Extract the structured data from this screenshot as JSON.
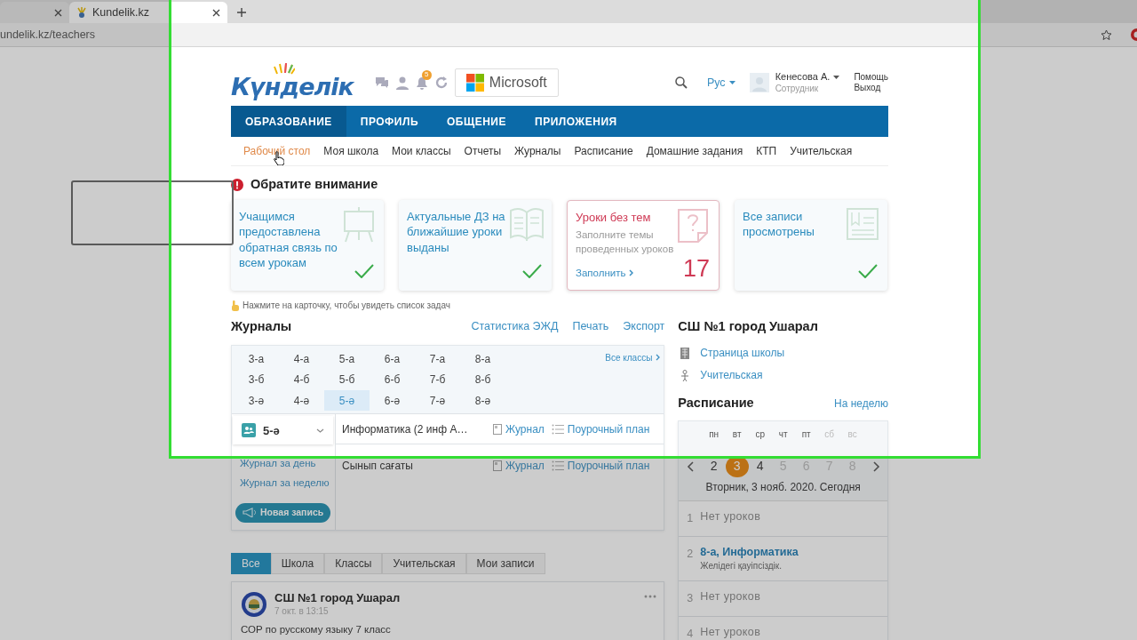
{
  "browser": {
    "tabs": [
      {
        "selected": false
      },
      {
        "title": "Kundelik.kz",
        "selected": true
      }
    ],
    "address": "undelik.kz/teachers"
  },
  "header": {
    "logo": "Күнделік",
    "notifications": "5",
    "microsoft": "Microsoft",
    "language": "Рус",
    "user": {
      "name": "Кенесова А.",
      "role": "Сотрудник"
    },
    "links": [
      "Помощь",
      "Выход"
    ]
  },
  "nav": [
    {
      "label": "ОБРАЗОВАНИЕ",
      "selected": true
    },
    {
      "label": "ПРОФИЛЬ",
      "selected": false
    },
    {
      "label": "ОБЩЕНИЕ",
      "selected": false
    },
    {
      "label": "ПРИЛОЖЕНИЯ",
      "selected": false
    }
  ],
  "subnav": [
    {
      "label": "Рабочий стол",
      "selected": true
    },
    {
      "label": "Моя школа",
      "selected": false
    },
    {
      "label": "Мои классы",
      "selected": false
    },
    {
      "label": "Отчеты",
      "selected": false
    },
    {
      "label": "Журналы",
      "selected": false
    },
    {
      "label": "Расписание",
      "selected": false
    },
    {
      "label": "Домашние задания",
      "selected": false
    },
    {
      "label": "КТП",
      "selected": false
    },
    {
      "label": "Учительская",
      "selected": false
    }
  ],
  "attention": {
    "title": "Обратите внимание",
    "cards": [
      {
        "kind": "done",
        "title": "Учащимся предоставлена обратная связь по всем урокам"
      },
      {
        "kind": "done",
        "title": "Актуальные ДЗ на ближайшие уроки выданы"
      },
      {
        "kind": "todo",
        "title": "Уроки без тем",
        "text": "Заполните темы проведенных уроков",
        "action": "Заполнить",
        "count": "17"
      },
      {
        "kind": "done",
        "title": "Все записи просмотрены"
      }
    ],
    "hint": "Нажмите на карточку, чтобы увидеть список задач"
  },
  "journals": {
    "title": "Журналы",
    "links": [
      "Статистика ЭЖД",
      "Печать",
      "Экспорт"
    ],
    "all_classes": "Все классы",
    "classes": [
      [
        {
          "label": "3-а",
          "selected": false
        },
        {
          "label": "4-а",
          "selected": false
        },
        {
          "label": "5-а",
          "selected": false
        },
        {
          "label": "6-а",
          "selected": false
        },
        {
          "label": "7-а",
          "selected": false
        },
        {
          "label": "8-а",
          "selected": false
        }
      ],
      [
        {
          "label": "3-б",
          "selected": false
        },
        {
          "label": "4-б",
          "selected": false
        },
        {
          "label": "5-б",
          "selected": false
        },
        {
          "label": "6-б",
          "selected": false
        },
        {
          "label": "7-б",
          "selected": false
        },
        {
          "label": "8-б",
          "selected": false
        }
      ],
      [
        {
          "label": "3-ә",
          "selected": false
        },
        {
          "label": "4-ә",
          "selected": false
        },
        {
          "label": "5-ә",
          "selected": true
        },
        {
          "label": "6-ә",
          "selected": false
        },
        {
          "label": "7-ә",
          "selected": false
        },
        {
          "label": "8-ә",
          "selected": false
        }
      ]
    ],
    "dropdown": "5-ә",
    "side_links": [
      "Журнал за день",
      "Журнал за неделю"
    ],
    "new_button": "Новая запись",
    "subjects": [
      {
        "name": "Информатика (2 инф А…",
        "journal": "Журнал",
        "plan": "Поурочный план"
      },
      {
        "name": "Сынып сағаты",
        "journal": "Журнал",
        "plan": "Поурочный план"
      }
    ]
  },
  "school": {
    "title": "СШ №1 город Ушарал",
    "links": [
      {
        "label": "Страница школы",
        "kind": "page"
      },
      {
        "label": "Учительская",
        "kind": "staff"
      }
    ]
  },
  "schedule": {
    "title": "Расписание",
    "week_link": "На неделю",
    "weekdays": [
      {
        "label": "пн",
        "dimmed": false
      },
      {
        "label": "вт",
        "dimmed": false
      },
      {
        "label": "ср",
        "dimmed": false
      },
      {
        "label": "чт",
        "dimmed": false
      },
      {
        "label": "пт",
        "dimmed": false
      },
      {
        "label": "сб",
        "dimmed": true
      },
      {
        "label": "вс",
        "dimmed": true
      }
    ],
    "days": [
      {
        "label": "2",
        "selected": false,
        "dimmed": false
      },
      {
        "label": "3",
        "selected": true,
        "dimmed": false
      },
      {
        "label": "4",
        "selected": false,
        "dimmed": false
      },
      {
        "label": "5",
        "selected": false,
        "dimmed": true
      },
      {
        "label": "6",
        "selected": false,
        "dimmed": true
      },
      {
        "label": "7",
        "selected": false,
        "dimmed": true
      },
      {
        "label": "8",
        "selected": false,
        "dimmed": true
      }
    ],
    "date": "Вторник, 3 нояб. 2020. Сегодня",
    "lessons": [
      {
        "number": "1",
        "kind": "empty",
        "title": "Нет уроков"
      },
      {
        "number": "2",
        "kind": "lesson",
        "title": "8-а, Информатика",
        "subtitle": "Желідегі қауіпсіздік."
      },
      {
        "number": "3",
        "kind": "empty",
        "title": "Нет уроков"
      },
      {
        "number": "4",
        "kind": "empty",
        "title": "Нет уроков"
      }
    ]
  },
  "feed": {
    "tabs": [
      {
        "label": "Все",
        "selected": true
      },
      {
        "label": "Школа",
        "selected": false
      },
      {
        "label": "Классы",
        "selected": false
      },
      {
        "label": "Учительская",
        "selected": false
      },
      {
        "label": "Мои записи",
        "selected": false
      }
    ],
    "post": {
      "author": "СШ №1 город Ушарал",
      "time": "7 окт. в 13:15",
      "text": "СОР по русскому языку 7 класс"
    }
  }
}
